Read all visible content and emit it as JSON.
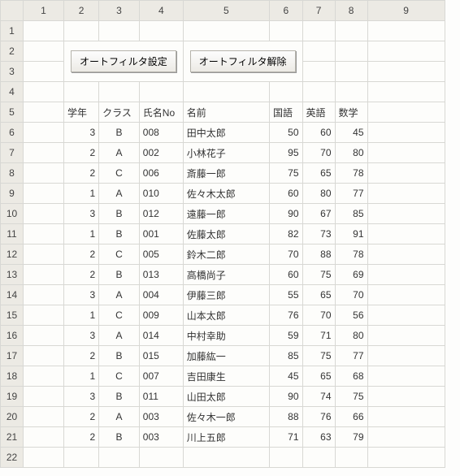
{
  "columns": [
    "1",
    "2",
    "3",
    "4",
    "5",
    "6",
    "7",
    "8",
    "9"
  ],
  "buttons": {
    "set_filter": "オートフィルタ設定",
    "clear_filter": "オートフィルタ解除"
  },
  "headers": {
    "grade": "学年",
    "class": "クラス",
    "name_no": "氏名No",
    "name": "名前",
    "kokugo": "国語",
    "eigo": "英語",
    "sugaku": "数学"
  },
  "rows": [
    {
      "grade": 3,
      "class": "B",
      "no": "008",
      "name": "田中太郎",
      "kokugo": 50,
      "eigo": 60,
      "sugaku": 45
    },
    {
      "grade": 2,
      "class": "A",
      "no": "002",
      "name": "小林花子",
      "kokugo": 95,
      "eigo": 70,
      "sugaku": 80
    },
    {
      "grade": 2,
      "class": "C",
      "no": "006",
      "name": "斎藤一郎",
      "kokugo": 75,
      "eigo": 65,
      "sugaku": 78
    },
    {
      "grade": 1,
      "class": "A",
      "no": "010",
      "name": "佐々木太郎",
      "kokugo": 60,
      "eigo": 80,
      "sugaku": 77
    },
    {
      "grade": 3,
      "class": "B",
      "no": "012",
      "name": "遠藤一郎",
      "kokugo": 90,
      "eigo": 67,
      "sugaku": 85
    },
    {
      "grade": 1,
      "class": "B",
      "no": "001",
      "name": "佐藤太郎",
      "kokugo": 82,
      "eigo": 73,
      "sugaku": 91
    },
    {
      "grade": 2,
      "class": "C",
      "no": "005",
      "name": "鈴木二郎",
      "kokugo": 70,
      "eigo": 88,
      "sugaku": 78
    },
    {
      "grade": 2,
      "class": "B",
      "no": "013",
      "name": "高橋尚子",
      "kokugo": 60,
      "eigo": 75,
      "sugaku": 69
    },
    {
      "grade": 3,
      "class": "A",
      "no": "004",
      "name": "伊藤三郎",
      "kokugo": 55,
      "eigo": 65,
      "sugaku": 70
    },
    {
      "grade": 1,
      "class": "C",
      "no": "009",
      "name": "山本太郎",
      "kokugo": 76,
      "eigo": 70,
      "sugaku": 56
    },
    {
      "grade": 3,
      "class": "A",
      "no": "014",
      "name": "中村幸助",
      "kokugo": 59,
      "eigo": 71,
      "sugaku": 80
    },
    {
      "grade": 2,
      "class": "B",
      "no": "015",
      "name": "加藤紘一",
      "kokugo": 85,
      "eigo": 75,
      "sugaku": 77
    },
    {
      "grade": 1,
      "class": "C",
      "no": "007",
      "name": "吉田康生",
      "kokugo": 45,
      "eigo": 65,
      "sugaku": 68
    },
    {
      "grade": 3,
      "class": "B",
      "no": "011",
      "name": "山田太郎",
      "kokugo": 90,
      "eigo": 74,
      "sugaku": 75
    },
    {
      "grade": 2,
      "class": "A",
      "no": "003",
      "name": "佐々木一郎",
      "kokugo": 88,
      "eigo": 76,
      "sugaku": 66
    },
    {
      "grade": 2,
      "class": "B",
      "no": "003",
      "name": "川上五郎",
      "kokugo": 71,
      "eigo": 63,
      "sugaku": 79
    }
  ]
}
